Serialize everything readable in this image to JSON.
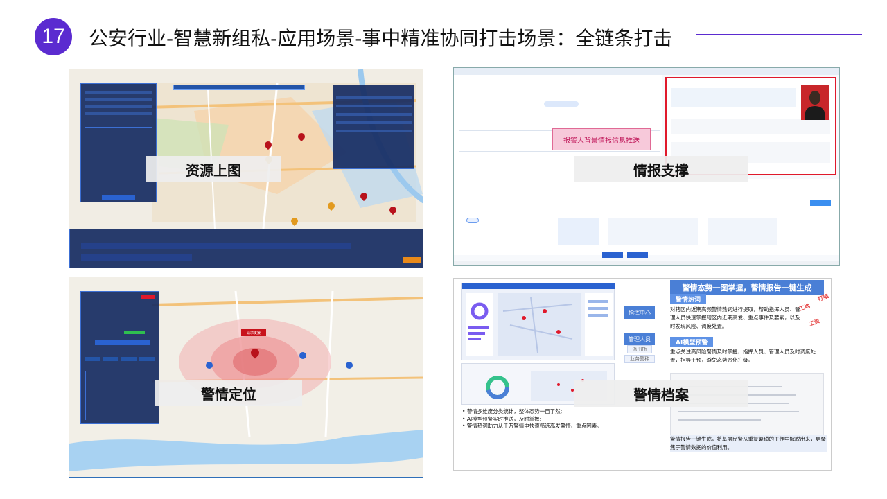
{
  "header": {
    "number": "17",
    "title": "公安行业-智慧新组私-应用场景-事中精准协同打击场景：全链条打击"
  },
  "panels": {
    "resource": {
      "label": "资源上图"
    },
    "intel": {
      "label": "情报支撑",
      "push_banner": "报警人背景情报信息推送"
    },
    "location": {
      "label": "警情定位",
      "callout": "请求支援"
    },
    "archive": {
      "label": "警情档案",
      "headline": "警情态势一图掌握，警情报告一键生成",
      "hotword_title": "警情热词",
      "hotword_text": "对辖区内近期高频警情热词进行提取，帮助指挥人员、管理人员快速掌握辖区内近期高发、重点事件及要素，以及时发现风险、调度处置。",
      "ai_title": "AI模型预警",
      "ai_text": "重点关注高风险警情及时掌握，指挥人员、管理人员及时调度处置，指导干预，避免态势恶化升级。",
      "btn_command": "指挥中心",
      "btn_manager": "管理人员",
      "btn_station": "派出所",
      "btn_business": "业务警种",
      "stamps": [
        "打架",
        "工地",
        "工资"
      ],
      "bullets": [
        "警情多维度分类统计，整体态势一目了然;",
        "AI模型预警实时推送，及时掌握;",
        "警情热词助力从千万警情中快速筛选高发警情、重点因素。"
      ],
      "report_text": "警情报告一键生成，将基层民警从重复繁琐的工作中解脱出来，更聚焦于警情数据的价值利用。"
    }
  },
  "colors": {
    "accent": "#5b2bd0",
    "map_dark": "#162b62",
    "alert_red": "#e0192b",
    "blue": "#4a7fd6"
  }
}
